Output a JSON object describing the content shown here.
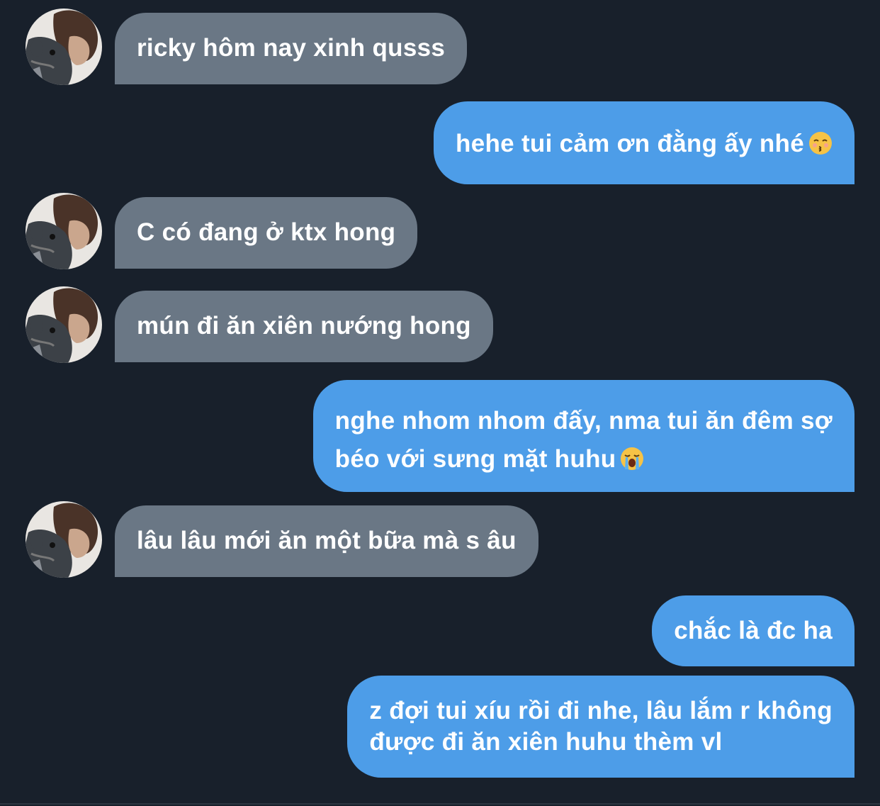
{
  "conversation": {
    "messages": [
      {
        "direction": "in",
        "lines": [
          "ricky hôm nay xinh qusss"
        ]
      },
      {
        "direction": "out",
        "lines": [
          "hehe tui cảm ơn đằng ấy nhé"
        ],
        "emoji": "kissing-face-closed-eyes"
      },
      {
        "direction": "in",
        "lines": [
          "C có đang ở ktx hong"
        ]
      },
      {
        "direction": "in",
        "lines": [
          "mún đi ăn xiên nướng hong"
        ]
      },
      {
        "direction": "out",
        "lines": [
          "nghe nhom nhom đấy, nma tui ăn đêm sợ",
          "béo với sưng mặt huhu"
        ],
        "emoji": "loudly-crying-face"
      },
      {
        "direction": "in",
        "lines": [
          "lâu lâu mới ăn một bữa mà s âu"
        ]
      },
      {
        "direction": "out",
        "lines": [
          "chắc là đc ha"
        ]
      },
      {
        "direction": "out",
        "lines": [
          "z đợi tui xíu rồi đi nhe, lâu lắm r không",
          "được đi ăn xiên huhu thèm vl"
        ]
      }
    ]
  },
  "colors": {
    "background": "#18202b",
    "incoming_bubble": "#6a7785",
    "outgoing_bubble": "#4d9de8",
    "text": "#ffffff"
  },
  "icons": {
    "avatar": "avatar-photo",
    "emoji_1": "kissing-face-closed-eyes",
    "emoji_2": "loudly-crying-face"
  }
}
